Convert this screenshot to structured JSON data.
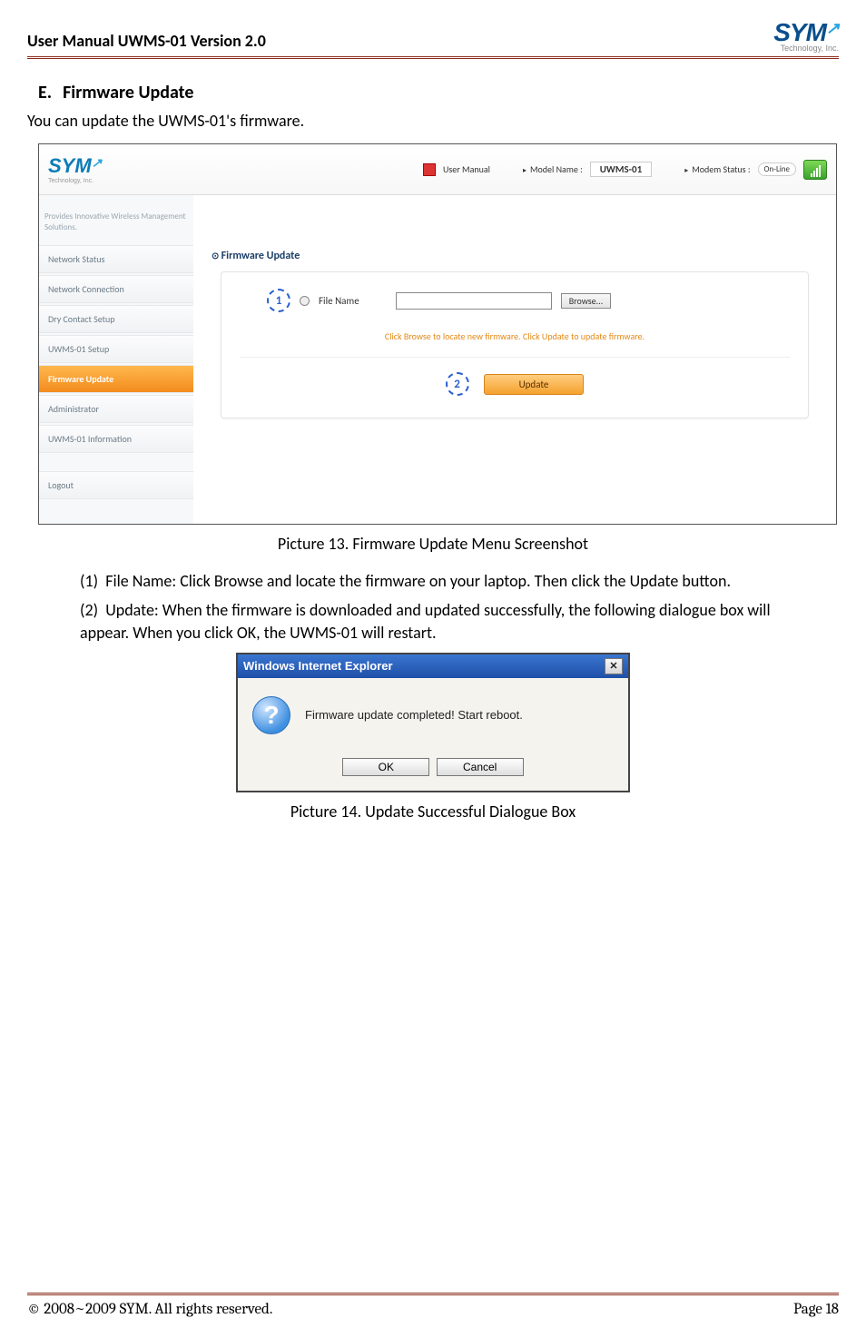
{
  "header": {
    "doc_title": "User Manual UWMS-01 Version 2.0",
    "logo_text": "SYM",
    "logo_tag": "Technology, Inc."
  },
  "section": {
    "letter": "E.",
    "title": "Firmware Update",
    "intro": "You can update the UWMS-01's firmware."
  },
  "screenshot1": {
    "logo_text": "SYM",
    "logo_tag": "Technology, Inc.",
    "user_manual_link": "User Manual",
    "model_label": "Model Name  :",
    "model_value": "UWMS-01",
    "modem_label": "Modem Status  :",
    "modem_value": "On-Line",
    "side_caption": "Provides Innovative Wireless Management Solutions.",
    "nav": {
      "n1": "Network Status",
      "n2": "Network Connection",
      "n3": "Dry Contact Setup",
      "n4": "UWMS-01 Setup",
      "n5": "Firmware Update",
      "n6": "Administrator",
      "n7": "UWMS-01 Information",
      "n8": "Logout"
    },
    "panel_title": "Firmware Update",
    "file_name_label": "File Name",
    "browse_label": "Browse...",
    "help_text": "Click Browse to locate new firmware. Click Update to update firmware.",
    "update_label": "Update",
    "callout1": "1",
    "callout2": "2"
  },
  "fig1_caption": "Picture  13. Firmware Update Menu Screenshot",
  "steps": {
    "s1_num": "(1)",
    "s1": "File Name: Click Browse and locate the firmware on your laptop.  Then click the Update button.",
    "s2_num": "(2)",
    "s2": "Update: When the firmware is downloaded and updated successfully, the following dialogue box will appear.  When you click OK, the UWMS-01 will restart."
  },
  "dialog": {
    "title": "Windows Internet Explorer",
    "message": "Firmware update completed! Start reboot.",
    "ok": "OK",
    "cancel": "Cancel"
  },
  "fig2_caption": "Picture  14. Update Successful Dialogue Box",
  "footer": {
    "copyright": "©  2008~2009 SYM.  All rights reserved.",
    "page": "Page 18"
  }
}
